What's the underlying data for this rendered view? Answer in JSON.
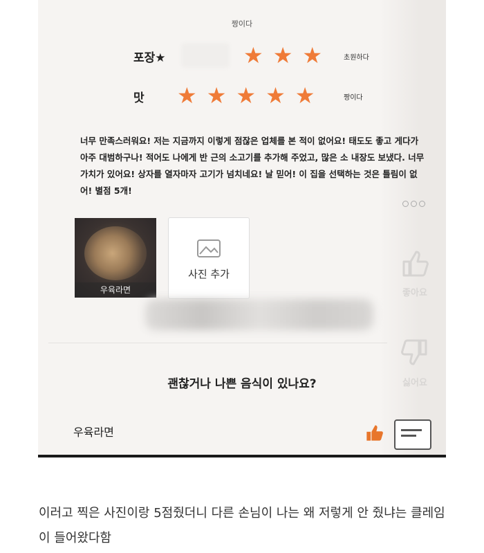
{
  "top_note": "짱이다",
  "rows": [
    {
      "label": "포장★",
      "filled_stars": 3,
      "note": "초원하다"
    },
    {
      "label": "맛",
      "filled_stars": 5,
      "note": "짱이다"
    }
  ],
  "review_text": "너무 만족스러워요! 저는 지금까지 이렇게 점잖은 업체를 본 적이 없어요! 태도도 좋고 게다가 아주 대범하구나! 적어도 나에게 반 근의 소고기를 추가해 주었고, 많은 소 내장도 보냈다. 너무 가치가 있어요! 상자를 열자마자 고기가 넘치네요! 날 믿어! 이 집을 선택하는 것은 틀림이 없어! 별점 5개!",
  "photo_label": "우육라면",
  "add_photo_label": "사진 추가",
  "like_label": "좋아요",
  "dislike_label": "싫어요",
  "question": "괜찮거나 나쁜 음식이 있나요?",
  "footer_item": "우육라면",
  "caption": "이러고 찍은 사진이랑 5점줬더니 다른 손님이 나는 왜 저렇게 안 줬냐는 클레임이 들어왔다함",
  "colors": {
    "star": "#ef7b38",
    "thumb_accent": "#e8762c"
  }
}
